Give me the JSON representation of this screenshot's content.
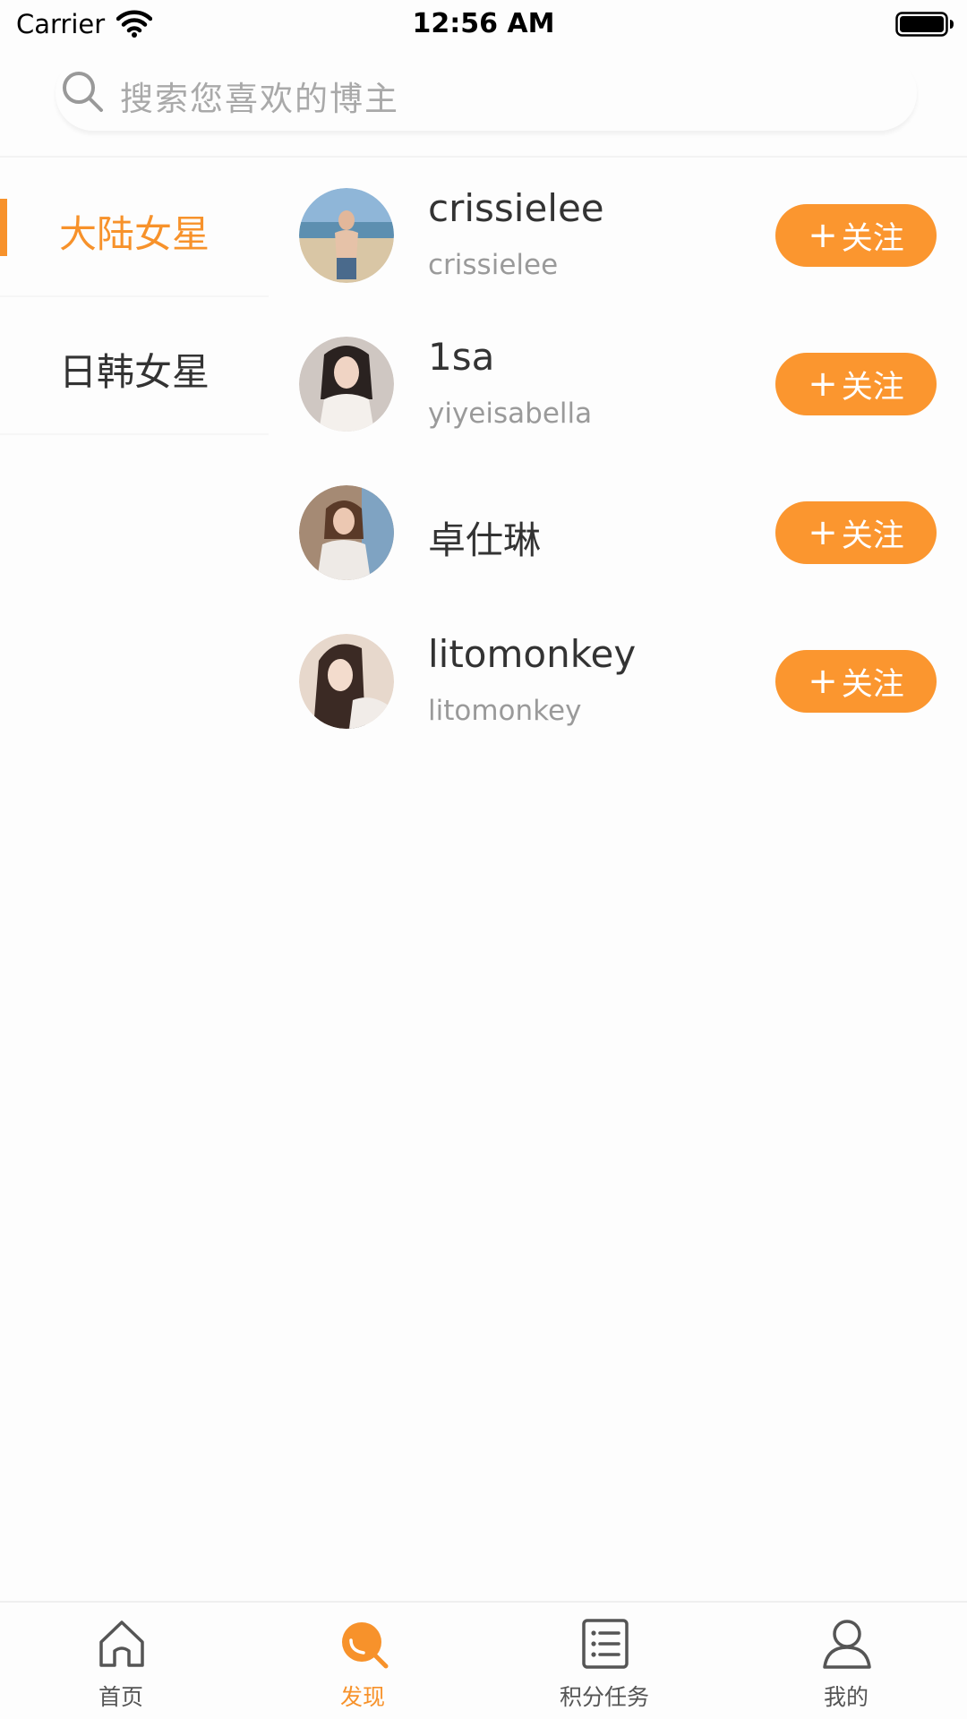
{
  "status_bar": {
    "carrier": "Carrier",
    "time": "12:56 AM"
  },
  "search": {
    "placeholder": "搜索您喜欢的博主"
  },
  "categories": [
    {
      "label": "大陆女星",
      "active": true
    },
    {
      "label": "日韩女星",
      "active": false
    }
  ],
  "bloggers": [
    {
      "name": "crissielee",
      "handle": "crissielee",
      "follow_label": "关注"
    },
    {
      "name": "1sa",
      "handle": "yiyeisabella",
      "follow_label": "关注"
    },
    {
      "name": "卓仕琳",
      "handle": "",
      "follow_label": "关注"
    },
    {
      "name": "litomonkey",
      "handle": "litomonkey",
      "follow_label": "关注"
    }
  ],
  "tab_bar": [
    {
      "label": "首页",
      "icon": "home-icon",
      "active": false
    },
    {
      "label": "发现",
      "icon": "discover-icon",
      "active": true
    },
    {
      "label": "积分任务",
      "icon": "task-list-icon",
      "active": false
    },
    {
      "label": "我的",
      "icon": "profile-icon",
      "active": false
    }
  ],
  "colors": {
    "accent": "#F7922B",
    "button": "#FB962F",
    "text": "#333333",
    "subtext": "#9A9A9A"
  }
}
